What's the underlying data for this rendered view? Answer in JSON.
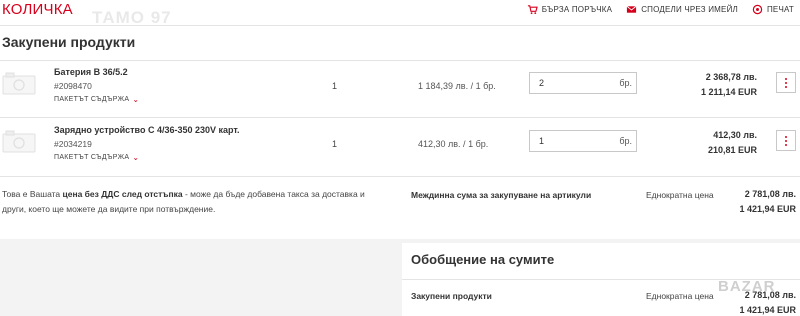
{
  "header": {
    "title": "КОЛИЧКА",
    "ghost_text": "ТАМО 97",
    "actions": [
      {
        "label": "БЪРЗА ПОРЪЧКА",
        "icon": "quick-order-cart-icon"
      },
      {
        "label": "СПОДЕЛИ ЧРЕЗ ИМЕЙЛ",
        "icon": "email-icon"
      },
      {
        "label": "ПЕЧАТ",
        "icon": "print-icon"
      }
    ]
  },
  "section": {
    "title": "Закупени продукти"
  },
  "products": [
    {
      "name": "Батерия B 36/5.2",
      "code": "#2098470",
      "package_label": "ПАКЕТЪТ СЪДЪРЖА",
      "quantity": "1",
      "unit_price": "1 184,39 лв. / 1 бр.",
      "input_value": "2",
      "uom": "бр.",
      "total_bgn": "2 368,78 лв.",
      "total_eur": "1 211,14 EUR"
    },
    {
      "name": "Зарядно устройство C 4/36-350 230V карт.",
      "code": "#2034219",
      "package_label": "ПАКЕТЪТ СЪДЪРЖА",
      "quantity": "1",
      "unit_price": "412,30 лв. / 1 бр.",
      "input_value": "1",
      "uom": "бр.",
      "total_bgn": "412,30 лв.",
      "total_eur": "210,81 EUR"
    }
  ],
  "note": {
    "before": "Това е Вашата ",
    "bold": "цена без ДДС след отстъпка",
    "after": " - може да бъде добавена такса за доставка и други, което ще можете да видите при потвърждение."
  },
  "subtotal": {
    "label": "Междинна сума за закупуване на артикули",
    "one_time_label": "Еднократна цена",
    "bgn": "2 781,08 лв.",
    "eur": "1 421,94 EUR"
  },
  "summary": {
    "title": "Обобщение на сумите",
    "row_label": "Закупени продукти",
    "one_time_label": "Еднократна цена",
    "bgn": "2 781,08 лв.",
    "eur": "1 421,94 EUR"
  },
  "watermark": "BAZAR",
  "colors": {
    "accent": "#d6001c",
    "text": "#333333",
    "border": "#e4e4e4"
  }
}
